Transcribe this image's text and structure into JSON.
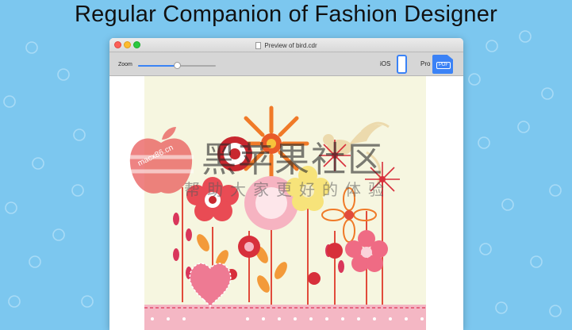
{
  "headline": "Regular Companion of Fashion Designer",
  "window": {
    "title": "Preview of bird.cdr",
    "traffic_lights": [
      "close",
      "minimize",
      "zoom"
    ]
  },
  "toolbar": {
    "zoom_label": "Zoom",
    "zoom_level": 0.5,
    "ios_label": "iOS",
    "pro_label": "Pro",
    "pdf_icon_text": "PDF",
    "icons": [
      "iphone-icon",
      "pdf-file-icon"
    ]
  },
  "watermark": {
    "main": "黑苹果社区",
    "sub": "帮助大家更好的体验",
    "url": "macx86.cn"
  },
  "colors": {
    "background": "#7cc7ef",
    "accent": "#3b82f6",
    "artwork_bg": "#f6f6e0"
  }
}
